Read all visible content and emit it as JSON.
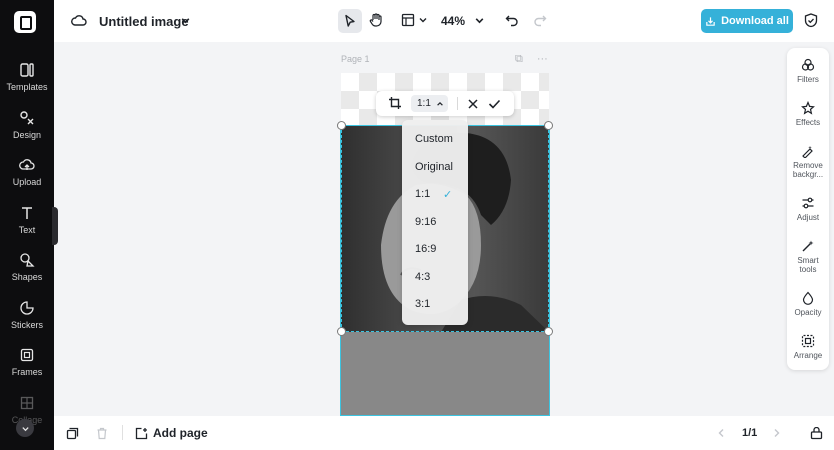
{
  "app": {
    "title": "Untitled image",
    "zoom": "44%",
    "download_label": "Download all",
    "accent_color": "#35b1d9"
  },
  "sidebar": {
    "items": [
      {
        "label": "Templates",
        "icon": "templates-icon"
      },
      {
        "label": "Design",
        "icon": "design-icon"
      },
      {
        "label": "Upload",
        "icon": "upload-icon"
      },
      {
        "label": "Text",
        "icon": "text-icon"
      },
      {
        "label": "Shapes",
        "icon": "shapes-icon"
      },
      {
        "label": "Stickers",
        "icon": "stickers-icon"
      },
      {
        "label": "Frames",
        "icon": "frames-icon"
      },
      {
        "label": "Collage",
        "icon": "collage-icon"
      }
    ]
  },
  "canvas": {
    "page_label": "Page 1"
  },
  "crop_toolbar": {
    "ratio_value": "1:1"
  },
  "ratio_menu": {
    "options": [
      "Custom",
      "Original",
      "1:1",
      "9:16",
      "16:9",
      "4:3",
      "3:1"
    ],
    "selected": "1:1"
  },
  "right_panel": {
    "items": [
      {
        "label": "Filters",
        "icon": "filters-icon"
      },
      {
        "label": "Effects",
        "icon": "effects-icon"
      },
      {
        "label": "Remove backgr...",
        "icon": "remove-background-icon"
      },
      {
        "label": "Adjust",
        "icon": "adjust-icon"
      },
      {
        "label": "Smart tools",
        "icon": "smart-tools-icon"
      },
      {
        "label": "Opacity",
        "icon": "opacity-icon"
      },
      {
        "label": "Arrange",
        "icon": "arrange-icon"
      }
    ]
  },
  "bottom": {
    "add_page_label": "Add page",
    "pager": "1/1"
  }
}
